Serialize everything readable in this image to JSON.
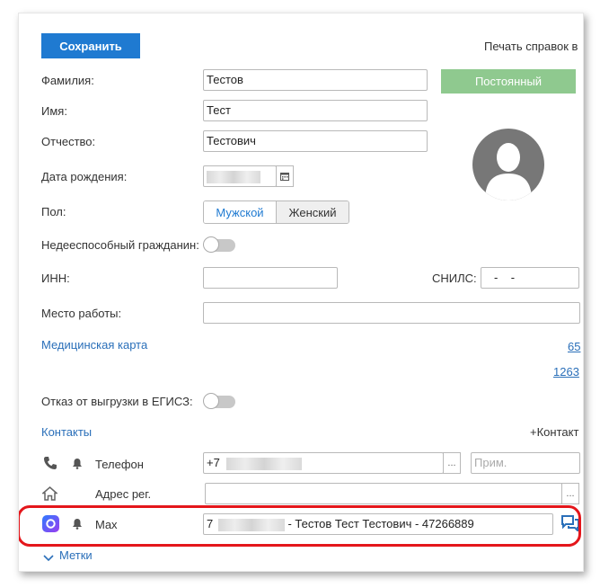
{
  "toolbar": {
    "save_label": "Сохранить",
    "print_label": "Печать справок в"
  },
  "form": {
    "surname_label": "Фамилия:",
    "surname_value": "Тестов",
    "name_label": "Имя:",
    "name_value": "Тест",
    "patronymic_label": "Отчество:",
    "patronymic_value": "Тестович",
    "birthdate_label": "Дата рождения:",
    "gender_label": "Пол:",
    "gender_options": [
      "Мужской",
      "Женский"
    ],
    "gender_selected": "Мужской",
    "incapable_label": "Недееспособный гражданин:",
    "inn_label": "ИНН:",
    "inn_value": "",
    "snils_label": "СНИЛС:",
    "snils_value": "-    -",
    "workplace_label": "Место работы:",
    "workplace_value": "",
    "status_button": "Постоянный"
  },
  "medical_card": {
    "label": "Медицинская карта",
    "link1": "65",
    "link2": "1263"
  },
  "egisz": {
    "label": "Отказ от выгрузки в ЕГИСЗ:"
  },
  "contacts": {
    "title": "Контакты",
    "add_label": "+Контакт",
    "phone": {
      "label": "Телефон",
      "value_prefix": "+7",
      "note_placeholder": "Прим.",
      "icon": "phone-icon"
    },
    "address": {
      "label": "Адрес рег.",
      "icon": "home-icon"
    },
    "max": {
      "label": "Max",
      "value_prefix": "7",
      "value_suffix": "- Тестов Тест Тестович - 47266889",
      "icon": "max-app-icon"
    },
    "dots": "..."
  },
  "tags": {
    "label": "Метки"
  },
  "colors": {
    "accent": "#1f7ad1",
    "status": "#8fc98f",
    "link": "#2a6fb9",
    "highlight": "#e4161b"
  }
}
